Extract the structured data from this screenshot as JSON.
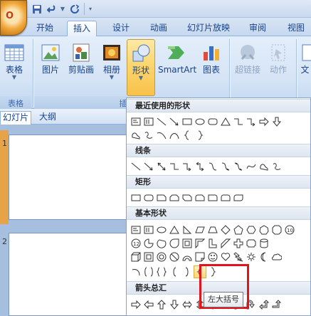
{
  "tabs": [
    "开始",
    "插入",
    "设计",
    "动画",
    "幻灯片放映",
    "审阅",
    "视图"
  ],
  "active_tab": "插入",
  "ribbon": {
    "buttons": [
      {
        "label": "表格",
        "icon": "table-icon"
      },
      {
        "label": "图片",
        "icon": "picture-icon"
      },
      {
        "label": "剪贴画",
        "icon": "clipart-icon"
      },
      {
        "label": "相册",
        "icon": "photo-album-icon"
      },
      {
        "label": "形状",
        "icon": "shapes-icon"
      },
      {
        "label": "SmartArt",
        "icon": "smartart-icon"
      },
      {
        "label": "图表",
        "icon": "chart-icon"
      },
      {
        "label": "超链接",
        "icon": "hyperlink-icon"
      },
      {
        "label": "动作",
        "icon": "action-icon"
      },
      {
        "label": "文",
        "icon": "textbox-icon"
      }
    ],
    "group_labels": [
      "表格",
      "插"
    ]
  },
  "left_panel": {
    "tabs": [
      "幻灯片",
      "大纲"
    ],
    "slides": [
      "1",
      "2"
    ]
  },
  "dropdown": {
    "sections": [
      "最近使用的形状",
      "线条",
      "矩形",
      "基本形状",
      "箭头总汇"
    ]
  },
  "tooltip": "左大括号",
  "colors": {
    "highlight_box": "#e0141c",
    "ribbon": "#d5e4f6",
    "selected_slide": "#e7a348"
  }
}
